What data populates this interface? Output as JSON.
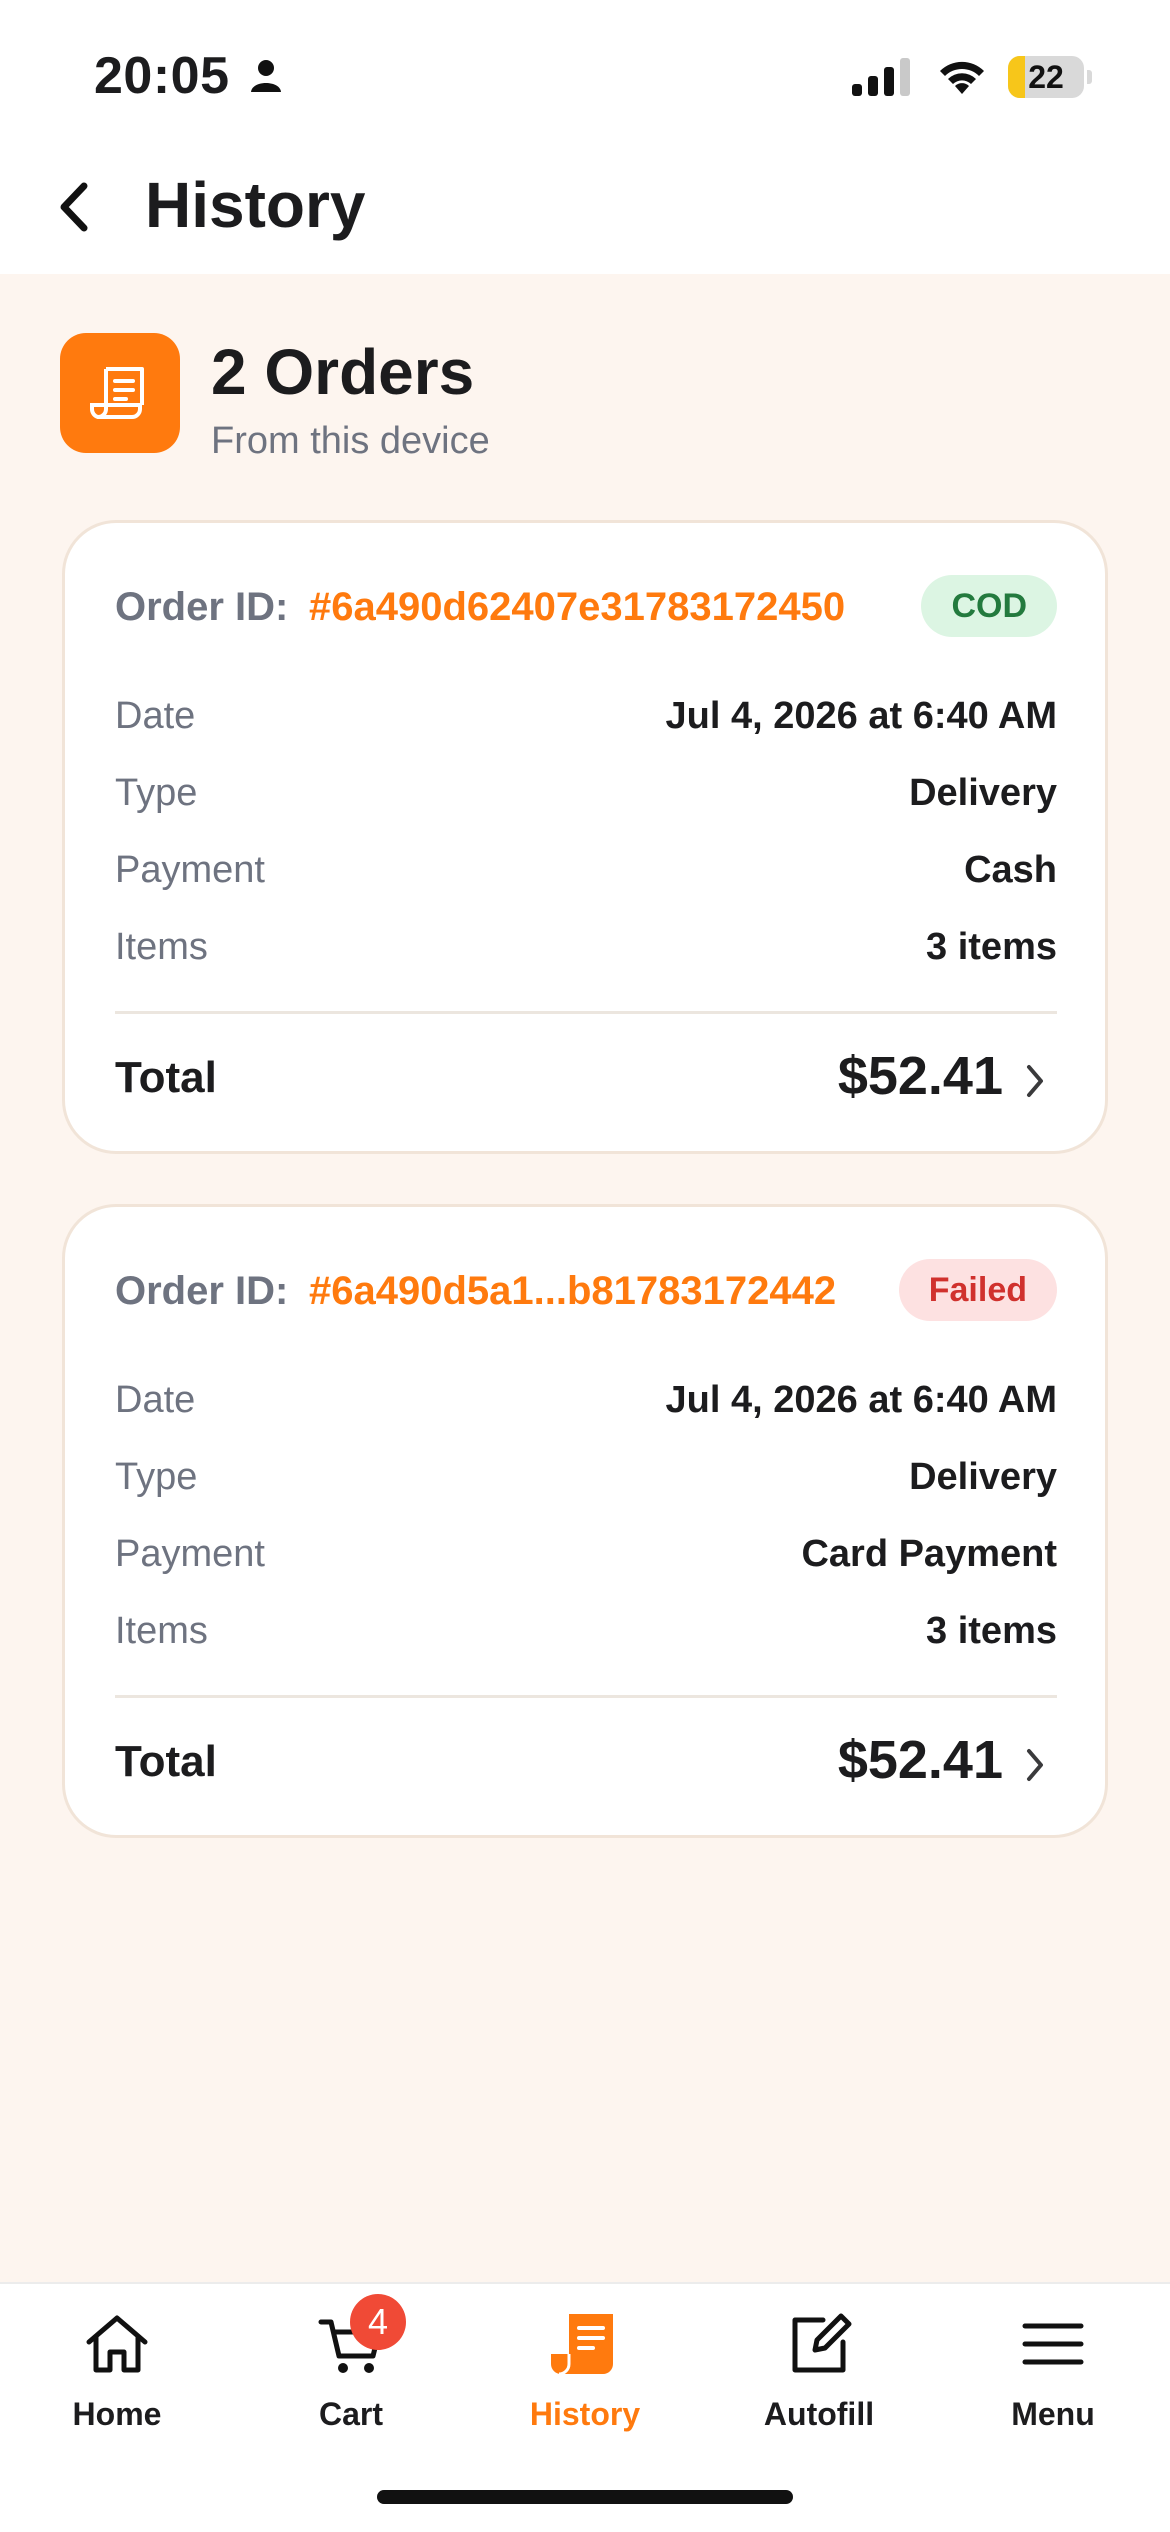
{
  "status_bar": {
    "time": "20:05",
    "battery_level": 22,
    "battery_text": "22",
    "icons": [
      "person-icon",
      "cellular-signal-icon",
      "wifi-icon",
      "battery-icon"
    ]
  },
  "header": {
    "title": "History",
    "back_icon": "chevron-left-icon"
  },
  "summary": {
    "title": "2 Orders",
    "subtitle": "From this device",
    "icon": "receipt-icon"
  },
  "orders": [
    {
      "id_label": "Order ID:",
      "id_value": "#6a490d62407e31783172450",
      "status": "COD",
      "date_label": "Date",
      "date_value": "Jul 4, 2026 at 6:40 AM",
      "type_label": "Type",
      "type_value": "Delivery",
      "payment_label": "Payment",
      "payment_value": "Cash",
      "items_label": "Items",
      "items_value": "3 items",
      "total_label": "Total",
      "total_value": "$52.41"
    },
    {
      "id_label": "Order ID:",
      "id_value": "#6a490d5a1...b81783172442",
      "status": "Failed",
      "date_label": "Date",
      "date_value": "Jul 4, 2026 at 6:40 AM",
      "type_label": "Type",
      "type_value": "Delivery",
      "payment_label": "Payment",
      "payment_value": "Card Payment",
      "items_label": "Items",
      "items_value": "3 items",
      "total_label": "Total",
      "total_value": "$52.41"
    }
  ],
  "tab_bar": {
    "tabs": [
      {
        "label": "Home",
        "icon": "home-icon"
      },
      {
        "label": "Cart",
        "icon": "cart-icon",
        "badge": "4"
      },
      {
        "label": "History",
        "icon": "receipt-icon",
        "active": true
      },
      {
        "label": "Autofill",
        "icon": "edit-icon"
      },
      {
        "label": "Menu",
        "icon": "menu-icon"
      }
    ]
  },
  "colors": {
    "accent": "#ff7a0e",
    "background": "#fdf5ef",
    "cod_badge": "#dcf5e3",
    "failed_badge": "#fde1e1",
    "cart_badge": "#f04a36"
  }
}
